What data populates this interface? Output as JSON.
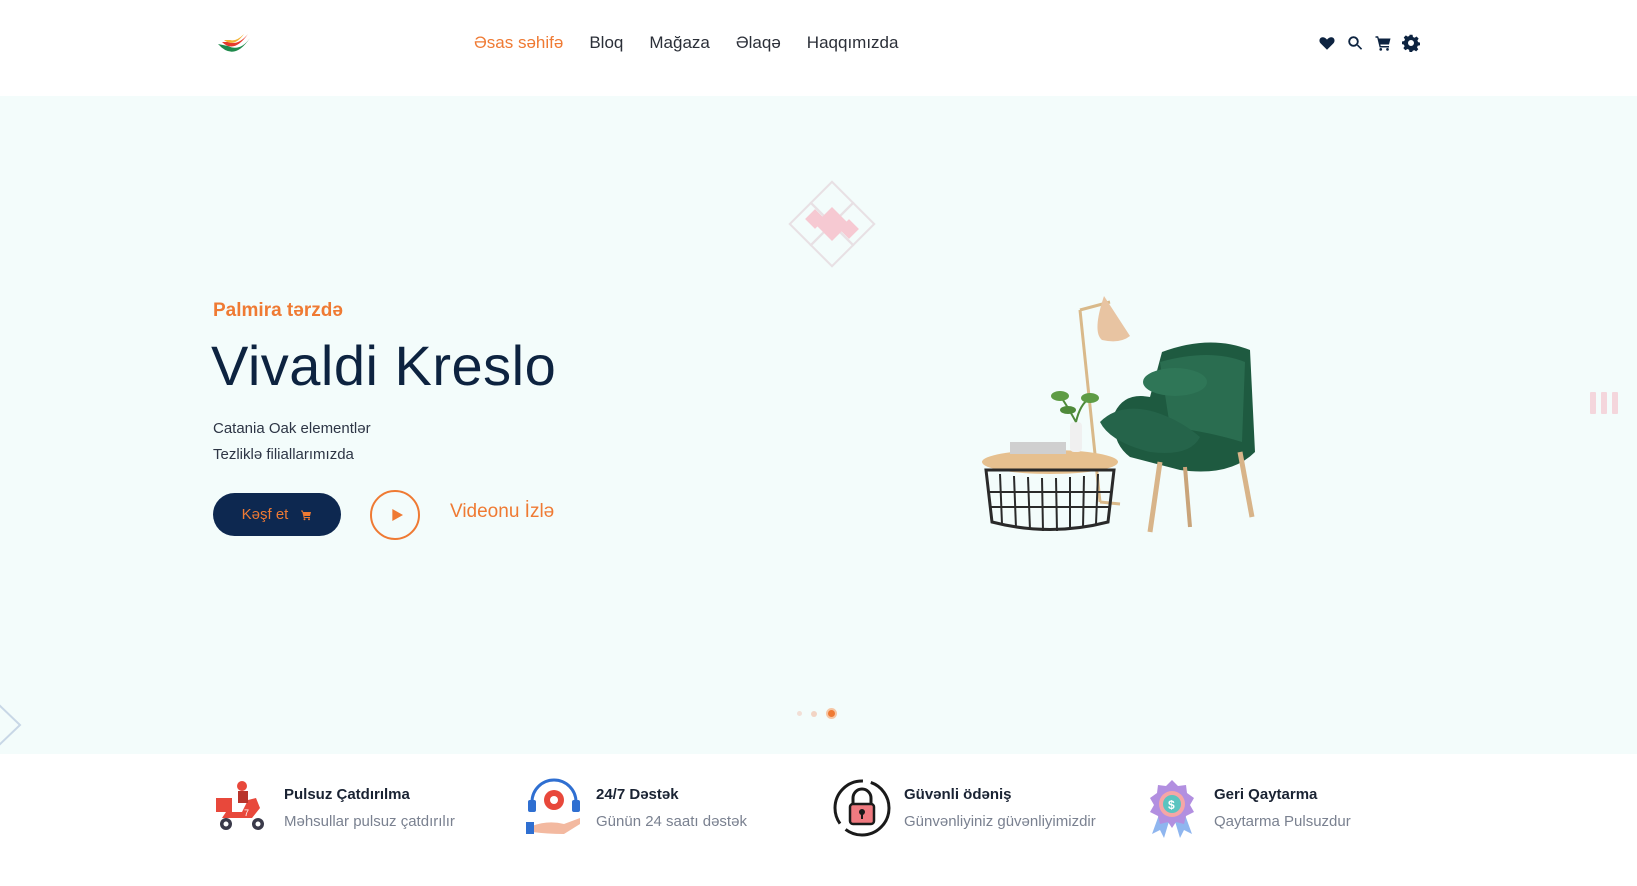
{
  "header": {
    "nav": [
      {
        "label": "Əsas səhifə",
        "active": true
      },
      {
        "label": "Bloq",
        "active": false
      },
      {
        "label": "Mağaza",
        "active": false
      },
      {
        "label": "Əlaqə",
        "active": false
      },
      {
        "label": "Haqqımızda",
        "active": false
      }
    ],
    "icons": [
      "heart-icon",
      "search-icon",
      "cart-icon",
      "gear-icon"
    ]
  },
  "hero": {
    "subtitle": "Palmira tərzdə",
    "title": "Vivaldi Kreslo",
    "desc_line1": "Catania Oak elementlər",
    "desc_line2": "Tezliklə filiallarımızda",
    "explore_label": "Kəşf et",
    "video_label": "Videonu İzlə",
    "slides": 3,
    "active_slide": 3
  },
  "features": [
    {
      "title": "Pulsuz Çatdırılma",
      "text": "Məhsullar pulsuz çatdırılır",
      "icon": "delivery-scooter-icon"
    },
    {
      "title": "24/7 Dəstək",
      "text": "Günün 24 saatı dəstək",
      "icon": "support-gear-icon"
    },
    {
      "title": "Güvənli ödəniş",
      "text": "Günvənliyiniz güvənliyimizdir",
      "icon": "padlock-icon"
    },
    {
      "title": "Geri Qaytarma",
      "text": "Qaytarma Pulsuzdur",
      "icon": "money-badge-icon"
    }
  ],
  "colors": {
    "accent": "#ef7a33",
    "navy": "#0d2850",
    "hero_bg": "#f3fcfb"
  }
}
